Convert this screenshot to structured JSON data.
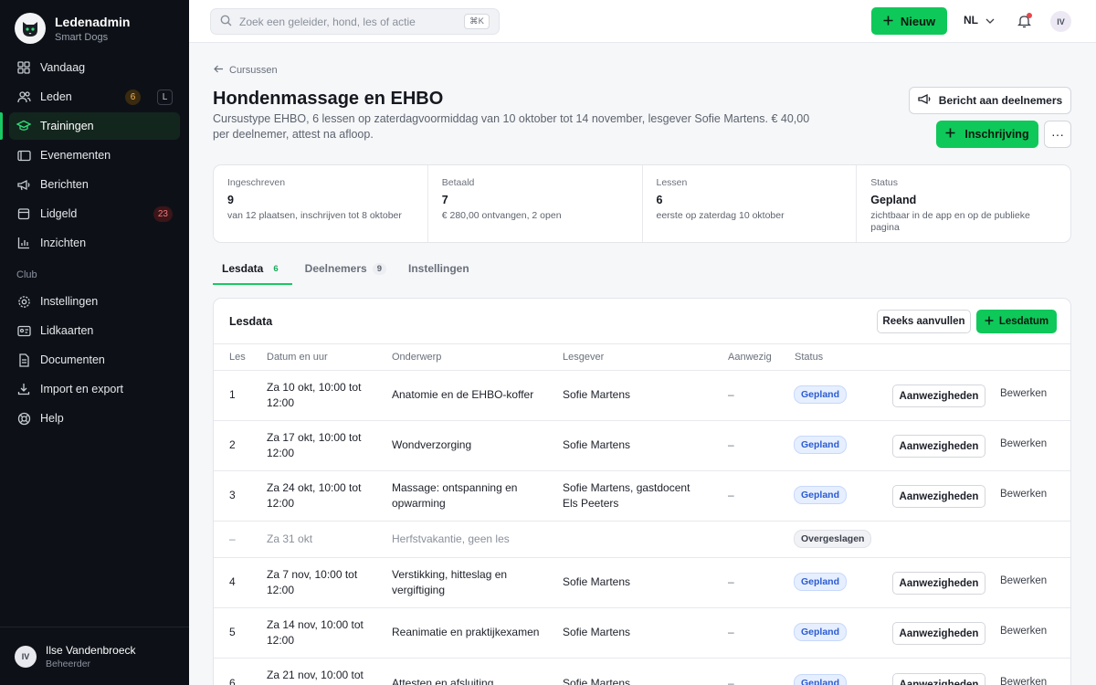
{
  "app": {
    "title": "Ledenadmin",
    "subtitle": "Smart Dogs"
  },
  "sidebar": {
    "items": [
      {
        "label": "Vandaag",
        "icon": "grid-icon"
      },
      {
        "label": "Leden",
        "icon": "users-icon",
        "badge": "6",
        "kbd": "L"
      },
      {
        "label": "Trainingen",
        "icon": "graduation-cap-icon",
        "active": true
      },
      {
        "label": "Evenementen",
        "icon": "ticket-icon"
      },
      {
        "label": "Berichten",
        "icon": "megaphone-icon"
      },
      {
        "label": "Lidgeld",
        "icon": "wallet-icon",
        "badge": "23"
      },
      {
        "label": "Inzichten",
        "icon": "bar-chart-icon"
      }
    ],
    "section_label": "Club",
    "club_items": [
      {
        "label": "Instellingen",
        "icon": "gear-icon"
      },
      {
        "label": "Lidkaarten",
        "icon": "id-card-icon"
      },
      {
        "label": "Documenten",
        "icon": "document-icon"
      },
      {
        "label": "Import en export",
        "icon": "download-icon"
      },
      {
        "label": "Help",
        "icon": "lifebuoy-icon"
      }
    ],
    "user": {
      "initials": "IV",
      "name": "Ilse Vandenbroeck",
      "role": "Beheerder"
    }
  },
  "topbar": {
    "search_placeholder": "Zoek een geleider, hond, les of actie",
    "search_kbd": "⌘K",
    "new_label": "Nieuw",
    "language": "NL",
    "avatar_initials": "IV"
  },
  "page": {
    "breadcrumb": "Cursussen",
    "title": "Hondenmassage en EHBO",
    "description": "Cursustype EHBO, 6 lessen op zaterdagvoormiddag van 10 oktober tot 14 november, lesgever Sofie Martens. € 40,00 per deelnemer, attest na afloop.",
    "message_button": "Bericht aan deelnemers",
    "enroll_button": "Inschrijving",
    "more_button": "···"
  },
  "stats": [
    {
      "label": "Ingeschreven",
      "value": "9",
      "note": "van 12 plaatsen, inschrijven tot 8 oktober"
    },
    {
      "label": "Betaald",
      "value": "7",
      "note": "€ 280,00 ontvangen, 2 open"
    },
    {
      "label": "Lessen",
      "value": "6",
      "note": "eerste op zaterdag 10 oktober"
    },
    {
      "label": "Status",
      "value": "Gepland",
      "note": "zichtbaar in de app en op de publieke pagina"
    }
  ],
  "tabs": [
    {
      "label": "Lesdata",
      "count": "6",
      "active": true
    },
    {
      "label": "Deelnemers",
      "count": "9"
    },
    {
      "label": "Instellingen"
    }
  ],
  "lesdata": {
    "title": "Lesdata",
    "fill_button": "Reeks aanvullen",
    "add_button": "Lesdatum",
    "columns": [
      "Les",
      "Datum en uur",
      "Onderwerp",
      "Lesgever",
      "Aanwezig",
      "Status"
    ],
    "attendance_button": "Aanwezigheden",
    "edit_link": "Bewerken",
    "rows": [
      {
        "les": "1",
        "date": "Za 10 okt, 10:00 tot 12:00",
        "topic": "Anatomie en de EHBO-koffer",
        "teacher": "Sofie Martens",
        "present": "–",
        "status": "Gepland"
      },
      {
        "les": "2",
        "date": "Za 17 okt, 10:00 tot 12:00",
        "topic": "Wondverzorging",
        "teacher": "Sofie Martens",
        "present": "–",
        "status": "Gepland"
      },
      {
        "les": "3",
        "date": "Za 24 okt, 10:00 tot 12:00",
        "topic": "Massage: ontspanning en opwarming",
        "teacher": "Sofie Martens, gastdocent Els Peeters",
        "present": "–",
        "status": "Gepland"
      },
      {
        "les": "–",
        "date": "Za 31 okt",
        "topic": "Herfstvakantie, geen les",
        "teacher": "",
        "present": "",
        "status": "Overgeslagen"
      },
      {
        "les": "4",
        "date": "Za 7 nov, 10:00 tot 12:00",
        "topic": "Verstikking, hitteslag en vergiftiging",
        "teacher": "Sofie Martens",
        "present": "–",
        "status": "Gepland"
      },
      {
        "les": "5",
        "date": "Za 14 nov, 10:00 tot 12:00",
        "topic": "Reanimatie en praktijkexamen",
        "teacher": "Sofie Martens",
        "present": "–",
        "status": "Gepland"
      },
      {
        "les": "6",
        "date": "Za 21 nov, 10:00 tot",
        "topic": "Attesten en afsluiting",
        "teacher": "Sofie Martens",
        "present": "–",
        "status": "Gepland"
      }
    ]
  },
  "colors": {
    "accent": "#0fc85a",
    "sidebar": "#0d1117",
    "status_blue": "#2b5bd1"
  }
}
